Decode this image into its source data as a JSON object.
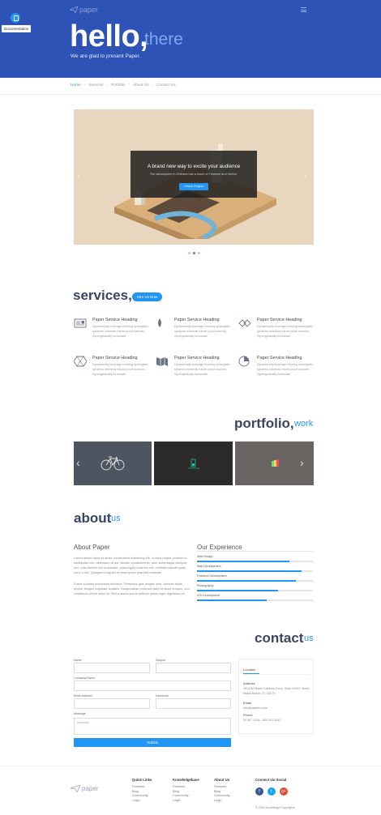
{
  "header": {
    "doc_tooltip": "Documentation",
    "logo": "paper",
    "hello": "hello,",
    "there": "there",
    "subtitle": "We are glad to present Paper."
  },
  "breadcrumbs": [
    "Home",
    "Services",
    "Portfolio",
    "About Us",
    "Contact Us"
  ],
  "slider": {
    "title": "A brand new way to excite your audience",
    "subtitle": "The atmosphere in Chelsea has a touch of Florence and Venice.",
    "button": "Check Project",
    "active_slide": 2,
    "slide_count": 3
  },
  "services": {
    "title": "services,",
    "button": "Hire Us Now",
    "items": [
      {
        "icon": "newspaper-icon",
        "heading": "Paper Service Heading",
        "text": "Dynamically leverage existing synergistic systems whereas future-proof sources Synergistically formulate"
      },
      {
        "icon": "drop-icon",
        "heading": "Paper Service Heading",
        "text": "Dynamically leverage existing synergistic systems whereas future-proof sources Synergistically formulate"
      },
      {
        "icon": "handshake-icon",
        "heading": "Paper Service Heading",
        "text": "Dynamically leverage existing synergistic systems whereas future-proof sources Synergistically formulate"
      },
      {
        "icon": "hexagon-icon",
        "heading": "Paper Service Heading",
        "text": "Dynamically leverage existing synergistic systems whereas future-proof sources Synergistically formulate"
      },
      {
        "icon": "map-icon",
        "heading": "Paper Service Heading",
        "text": "Dynamically leverage existing synergistic systems whereas future-proof sources Synergistically formulate"
      },
      {
        "icon": "pie-chart-icon",
        "heading": "Paper Service Heading",
        "text": "Dynamically leverage existing synergistic systems whereas future-proof sources Synergistically formulate"
      }
    ]
  },
  "portfolio": {
    "title": "portfolio,",
    "title_light": "work"
  },
  "about": {
    "title": "about",
    "title_light": "us",
    "about_heading": "About Paper",
    "para1": "Lorem ipsum dolor sit amet, consectetur adipiscing elit. In risus neque, pretium id sollicitudin nec, bibendum at leo. Nullam condimentum, sem scelerisque volutpat nec, odio laoreet orci in suscipit, purus ligula euismod est, molestie blandit quam nunc a nisl. Quisque id sapien et amet quam pharetra molestie.",
    "para2": "Fusce sodales accumsan tincidunt. Phasellus quis feugiat urna. Aenean tellus neque, feugiat vulputate sodales. Suspendisse euismod diam et lacus tempus, non vestibulum libero vitae mi. Sed a auctor purus pretium ipsum eget, dignissim mi.",
    "experience_heading": "Our Experience",
    "skills": [
      {
        "label": "Web Design",
        "level": 0.8
      },
      {
        "label": "Web Development",
        "level": 0.9
      },
      {
        "label": "Frontend Development",
        "level": 0.85
      },
      {
        "label": "Photography",
        "level": 0.7
      },
      {
        "label": "iOS Development",
        "level": 0.6
      }
    ]
  },
  "contact": {
    "title": "contact",
    "title_light": "us",
    "name_label": "Name",
    "subject_label": "Subject",
    "company_label": "Company Name",
    "email_label": "Email Address",
    "facebook_label": "Facebook",
    "message_label": "Message",
    "message_placeholder": "Message",
    "submit": "Submit",
    "location_tab": "Location",
    "address_h": "Address",
    "address": "1814 All Miami Gardens Drive, Suite #1007, North Miami Beach, FL 33179",
    "email_h": "Email",
    "email": "info@paperio.com",
    "phone_h": "Phone",
    "phone": "00 987 1234 - 800 123 2513"
  },
  "footer": {
    "logo": "paper",
    "columns": [
      {
        "heading": "Quick Links",
        "items": [
          "Features",
          "Blog",
          "Community",
          "Login"
        ]
      },
      {
        "heading": "Knowledgebase",
        "items": [
          "Features",
          "Blog",
          "Community",
          "Login"
        ]
      },
      {
        "heading": "About Us",
        "items": [
          "Features",
          "Blog",
          "Community",
          "Login"
        ]
      }
    ],
    "social_heading": "Connect via Social",
    "social": [
      {
        "icon": "facebook-icon",
        "glyph": "f",
        "color": "#3b5998"
      },
      {
        "icon": "twitter-icon",
        "glyph": "t",
        "color": "#1da1f2"
      },
      {
        "icon": "google-plus-icon",
        "glyph": "g+",
        "color": "#dd4b39"
      }
    ],
    "copyright": "© 2016 Knowledge Copyrights"
  }
}
